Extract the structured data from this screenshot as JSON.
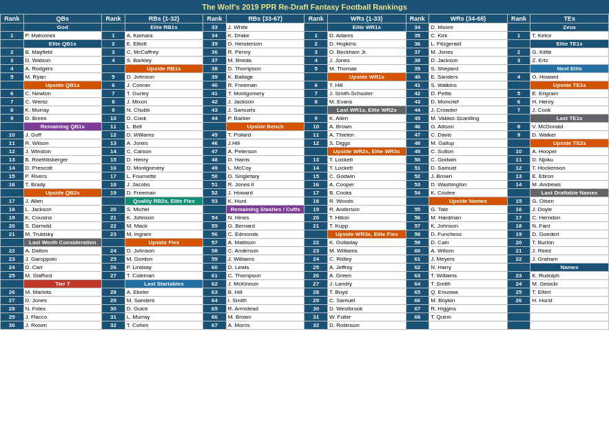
{
  "title": "The Wolf's 2019 PPR Re-Draft Fantasy Football Rankings",
  "headers": {
    "qb_rank": "Rank",
    "qb_label": "QBs",
    "rb1_rank": "Rank",
    "rb1_label": "RBs (1-32)",
    "rb2_rank": "Rank",
    "rb2_label": "RBs (33-67)",
    "wr1_rank": "Rank",
    "wr1_label": "WRs (1-33)",
    "wr2_rank": "Rank",
    "wr2_label": "WRs (34-68)",
    "te_rank": "Rank",
    "te_label": "TEs"
  },
  "columns": {
    "qbs": {
      "sections": [
        {
          "label": "Elite QB1s",
          "type": "blue"
        },
        {
          "label": "Upside QB1s",
          "type": "orange"
        },
        {
          "label": "Remaining QB1s",
          "type": "purple"
        },
        {
          "label": "Upside QB2s",
          "type": "orange"
        },
        {
          "label": "Last Worth Consideration",
          "type": "gray"
        },
        {
          "label": "Tier 7",
          "type": "red"
        }
      ],
      "players": [
        {
          "rank": "1",
          "name": "P. Mahomes"
        },
        {
          "rank": "",
          "name": "Elite QB1s"
        },
        {
          "rank": "2",
          "name": "B. Mayfield"
        },
        {
          "rank": "3",
          "name": "D. Watson"
        },
        {
          "rank": "4",
          "name": "A. Rodgers"
        },
        {
          "rank": "5",
          "name": "M. Ryan"
        },
        {
          "rank": "",
          "name": "Upside QB1s"
        },
        {
          "rank": "6",
          "name": "C. Newton"
        },
        {
          "rank": "7",
          "name": "C. Wentz"
        },
        {
          "rank": "8",
          "name": "K. Murray"
        },
        {
          "rank": "9",
          "name": "D. Brees"
        },
        {
          "rank": "",
          "name": "Remaining QB1s"
        },
        {
          "rank": "10",
          "name": "J. Goff"
        },
        {
          "rank": "11",
          "name": "R. Wilson"
        },
        {
          "rank": "12",
          "name": "J. Winston"
        },
        {
          "rank": "13",
          "name": "B. Roethlisberger"
        },
        {
          "rank": "14",
          "name": "D. Prescott"
        },
        {
          "rank": "15",
          "name": "P. Rivers"
        },
        {
          "rank": "16",
          "name": "T. Brady"
        },
        {
          "rank": "",
          "name": "Upside QB2s"
        },
        {
          "rank": "17",
          "name": "J. Allen"
        },
        {
          "rank": "18",
          "name": "L. Jackson"
        },
        {
          "rank": "19",
          "name": "K. Cousins"
        },
        {
          "rank": "20",
          "name": "S. Darnold"
        },
        {
          "rank": "21",
          "name": "M. Trubisky"
        },
        {
          "rank": "",
          "name": "Last Worth Consideration"
        },
        {
          "rank": "22",
          "name": "A. Dalton"
        },
        {
          "rank": "23",
          "name": "J. Garoppolo"
        },
        {
          "rank": "24",
          "name": "D. Carr"
        },
        {
          "rank": "25",
          "name": "M. Stafford"
        },
        {
          "rank": "",
          "name": "Tier 7"
        },
        {
          "rank": "26",
          "name": "M. Mariota"
        },
        {
          "rank": "27",
          "name": "D. Jones"
        },
        {
          "rank": "28",
          "name": "N. Foles"
        },
        {
          "rank": "29",
          "name": "J. Flacco"
        },
        {
          "rank": "30",
          "name": "J. Rosen"
        }
      ]
    }
  }
}
